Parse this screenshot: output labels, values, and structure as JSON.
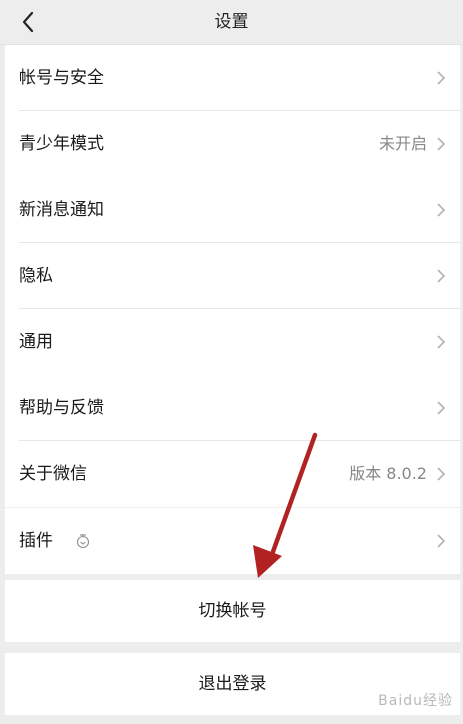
{
  "header": {
    "title": "设置"
  },
  "groups": [
    {
      "items": [
        {
          "label": "帐号与安全",
          "value": ""
        },
        {
          "label": "青少年模式",
          "value": "未开启"
        }
      ]
    },
    {
      "items": [
        {
          "label": "新消息通知",
          "value": ""
        },
        {
          "label": "隐私",
          "value": ""
        },
        {
          "label": "通用",
          "value": ""
        }
      ]
    },
    {
      "items": [
        {
          "label": "帮助与反馈",
          "value": ""
        },
        {
          "label": "关于微信",
          "value": "版本 8.0.2"
        }
      ]
    },
    {
      "items": [
        {
          "label": "插件",
          "value": ""
        }
      ]
    }
  ],
  "actions": {
    "switch_account": "切换帐号",
    "logout": "退出登录"
  },
  "watermark": "Baidu经验",
  "colors": {
    "background": "#ededed",
    "annotation_arrow": "#b22222"
  }
}
